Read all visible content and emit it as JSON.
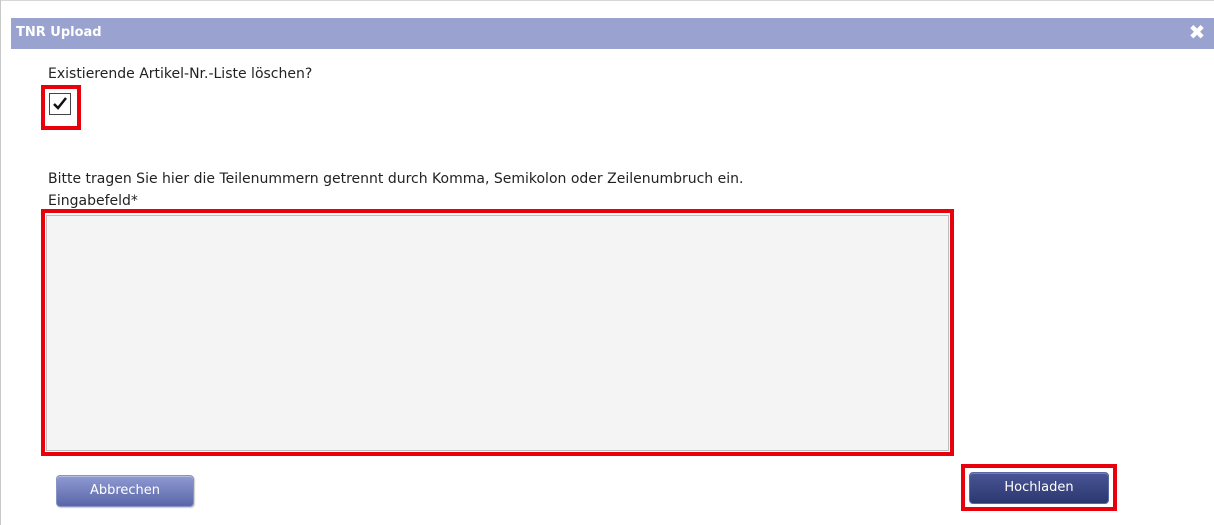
{
  "dialog": {
    "title": "TNR Upload",
    "close_icon": "close-icon"
  },
  "form": {
    "delete_question": "Existierende Artikel-Nr.-Liste löschen?",
    "delete_checked": true,
    "instructions": "Bitte tragen Sie hier die Teilenummern getrennt durch Komma, Semikolon oder Zeilenumbruch ein.",
    "input_label": "Eingabefeld*",
    "input_value": ""
  },
  "buttons": {
    "cancel_label": "Abbrechen",
    "upload_label": "Hochladen"
  },
  "colors": {
    "titlebar": "#9aa3cf",
    "highlight": "#e8000b",
    "textarea_bg": "#f4f4f4",
    "button_primary": "#2c386f",
    "button_secondary": "#6d78b8"
  }
}
